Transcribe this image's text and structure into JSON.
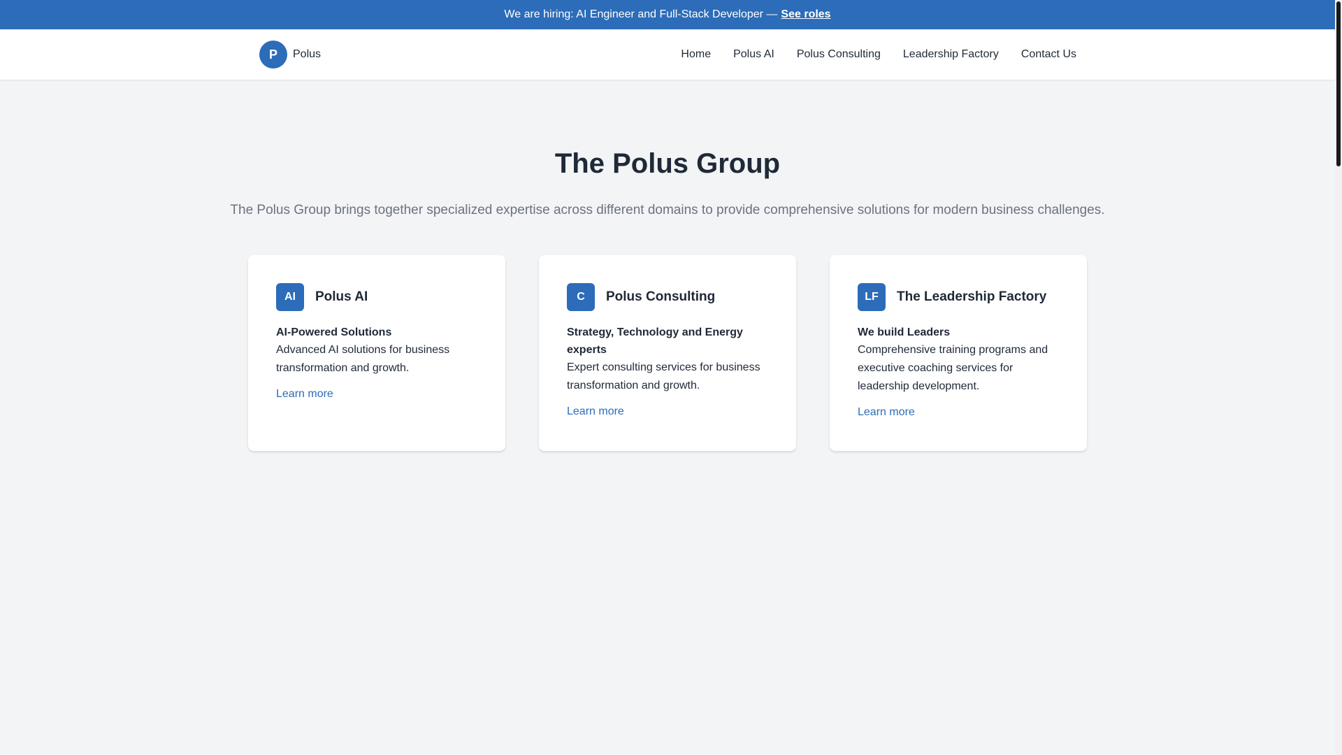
{
  "announcement": {
    "message": "We are hiring: AI Engineer and Full-Stack Developer —",
    "link_label": "See roles"
  },
  "brand": {
    "initial": "P",
    "name": "Polus"
  },
  "nav": {
    "items": [
      {
        "label": "Home"
      },
      {
        "label": "Polus AI"
      },
      {
        "label": "Polus Consulting"
      },
      {
        "label": "Leadership Factory"
      },
      {
        "label": "Contact Us"
      }
    ]
  },
  "hero": {
    "title": "The Polus Group",
    "subtitle": "The Polus Group brings together specialized expertise across different domains to provide comprehensive solutions for modern business challenges."
  },
  "cards": [
    {
      "badge": "AI",
      "title": "Polus AI",
      "tagline": "AI-Powered Solutions",
      "description": "Advanced AI solutions for business transformation and growth.",
      "link_label": "Learn more"
    },
    {
      "badge": "C",
      "title": "Polus Consulting",
      "tagline": "Strategy, Technology and Energy experts",
      "description": "Expert consulting services for business transformation and growth.",
      "link_label": "Learn more"
    },
    {
      "badge": "LF",
      "title": "The Leadership Factory",
      "tagline": "We build Leaders",
      "description": "Comprehensive training programs and executive coaching services for leadership development.",
      "link_label": "Learn more"
    }
  ],
  "colors": {
    "brand_blue": "#2c6cb8",
    "page_bg": "#f3f4f6",
    "text_dark": "#1f2937",
    "text_muted": "#6b7280"
  }
}
